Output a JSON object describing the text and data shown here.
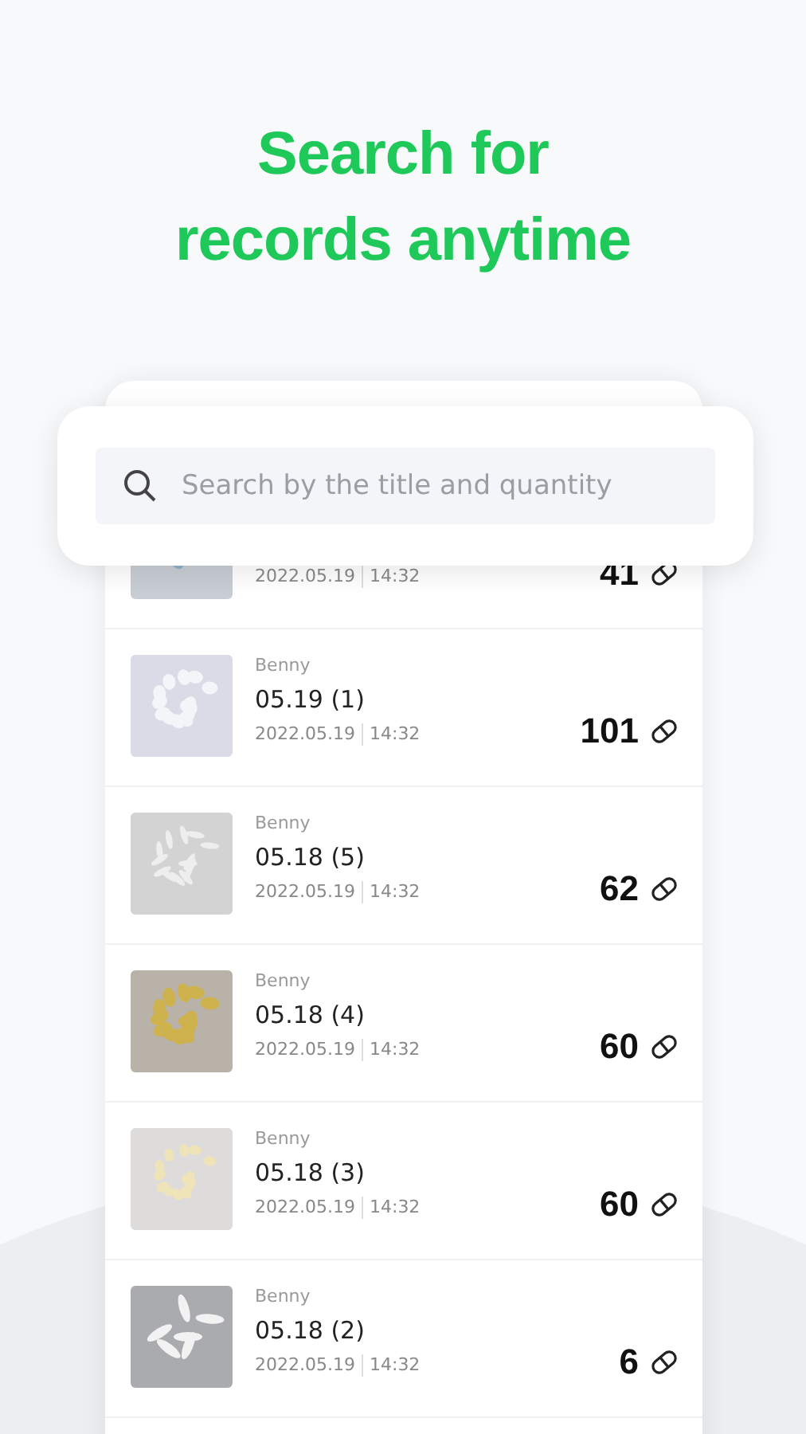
{
  "headline": [
    "Search for",
    "records anytime"
  ],
  "search": {
    "placeholder": "Search by the title and quantity"
  },
  "records": [
    {
      "date": "2022.05.19",
      "time": "14:32",
      "count": "41"
    },
    {
      "author": "Benny",
      "title": "05.19 (1)",
      "date": "2022.05.19",
      "time": "14:32",
      "count": "101"
    },
    {
      "author": "Benny",
      "title": "05.18 (5)",
      "date": "2022.05.19",
      "time": "14:32",
      "count": "62"
    },
    {
      "author": "Benny",
      "title": "05.18 (4)",
      "date": "2022.05.19",
      "time": "14:32",
      "count": "60"
    },
    {
      "author": "Benny",
      "title": "05.18 (3)",
      "date": "2022.05.19",
      "time": "14:32",
      "count": "60"
    },
    {
      "author": "Benny",
      "title": "05.18 (2)",
      "date": "2022.05.19",
      "time": "14:32",
      "count": "6"
    }
  ]
}
